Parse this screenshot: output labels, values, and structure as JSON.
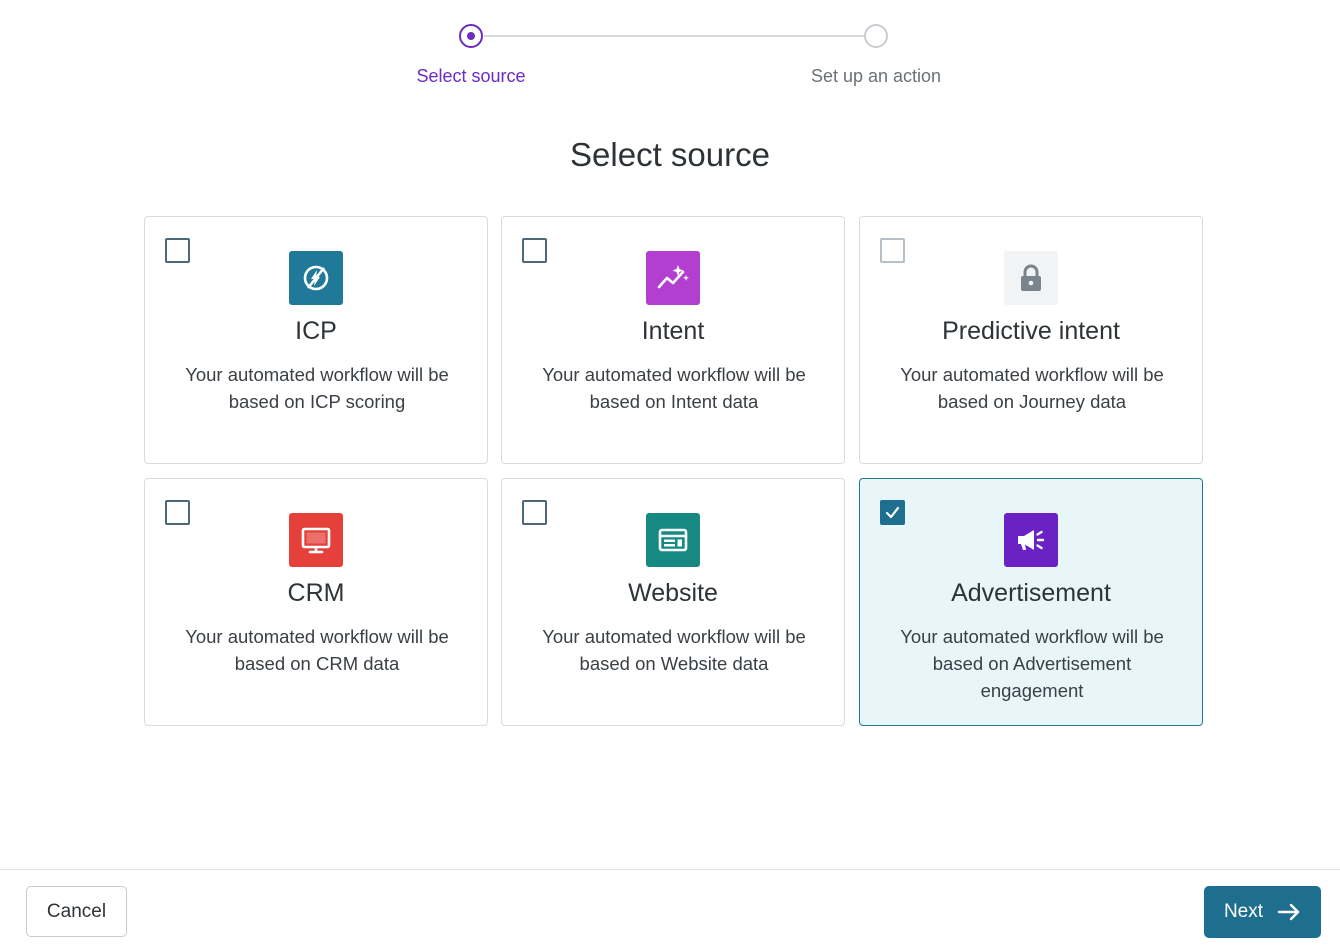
{
  "stepper": {
    "steps": [
      {
        "label": "Select source",
        "state": "active"
      },
      {
        "label": "Set up an action",
        "state": "inactive"
      }
    ]
  },
  "page_title": "Select source",
  "cards": [
    {
      "id": "icp",
      "title": "ICP",
      "description": "Your automated workflow will be based on ICP scoring",
      "icon": "flash-off-icon",
      "icon_color": "#21799a",
      "checked": false,
      "disabled": false
    },
    {
      "id": "intent",
      "title": "Intent",
      "description": "Your automated workflow will be based on Intent data",
      "icon": "sparkle-chart-icon",
      "icon_color": "#b23fcf",
      "checked": false,
      "disabled": false
    },
    {
      "id": "predictive",
      "title": "Predictive intent",
      "description": "Your automated workflow will be based on Journey data",
      "icon": "lock-icon",
      "icon_color": "#f2f3f4",
      "checked": false,
      "disabled": true
    },
    {
      "id": "crm",
      "title": "CRM",
      "description": "Your automated workflow will be based on CRM data",
      "icon": "monitor-icon",
      "icon_color": "#e5403a",
      "checked": false,
      "disabled": false
    },
    {
      "id": "website",
      "title": "Website",
      "description": "Your automated workflow will be based on Website data",
      "icon": "browser-icon",
      "icon_color": "#168a82",
      "checked": false,
      "disabled": false
    },
    {
      "id": "advertisement",
      "title": "Advertisement",
      "description": "Your automated workflow will be based on Advertisement engagement",
      "icon": "megaphone-icon",
      "icon_color": "#6a22c4",
      "checked": true,
      "disabled": false
    }
  ],
  "footer": {
    "cancel_label": "Cancel",
    "next_label": "Next"
  },
  "colors": {
    "accent_purple": "#6c2bc2",
    "primary_teal": "#1e6f8f",
    "selected_bg": "#e8f6fa"
  }
}
